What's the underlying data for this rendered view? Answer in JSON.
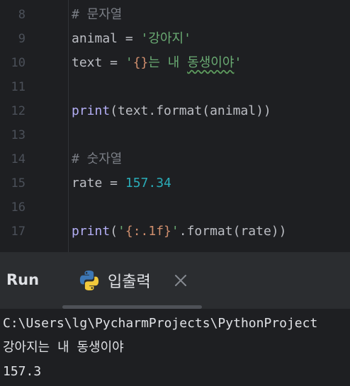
{
  "editor": {
    "lines": [
      {
        "num": "8",
        "parts": [
          {
            "t": "# 문자열",
            "c": "comment"
          }
        ]
      },
      {
        "num": "9",
        "parts": [
          {
            "t": "animal = ",
            "c": ""
          },
          {
            "t": "'강아지'",
            "c": "string"
          }
        ]
      },
      {
        "num": "10",
        "parts": [
          {
            "t": "text = ",
            "c": ""
          },
          {
            "t": "'",
            "c": "string"
          },
          {
            "t": "{}",
            "c": "brace"
          },
          {
            "t": "는 내 ",
            "c": "string"
          },
          {
            "t": "동생이야",
            "c": "string typo"
          },
          {
            "t": "'",
            "c": "string"
          }
        ]
      },
      {
        "num": "11",
        "parts": []
      },
      {
        "num": "12",
        "parts": [
          {
            "t": "print",
            "c": "func"
          },
          {
            "t": "(text.format(animal))",
            "c": ""
          }
        ]
      },
      {
        "num": "13",
        "parts": []
      },
      {
        "num": "14",
        "parts": [
          {
            "t": "# 숫자열",
            "c": "comment"
          }
        ]
      },
      {
        "num": "15",
        "parts": [
          {
            "t": "rate = ",
            "c": ""
          },
          {
            "t": "157.34",
            "c": "number"
          }
        ]
      },
      {
        "num": "16",
        "parts": []
      },
      {
        "num": "17",
        "parts": [
          {
            "t": "print",
            "c": "func"
          },
          {
            "t": "(",
            "c": ""
          },
          {
            "t": "'",
            "c": "string"
          },
          {
            "t": "{:.1f}",
            "c": "brace"
          },
          {
            "t": "'",
            "c": "string"
          },
          {
            "t": ".format(rate))",
            "c": ""
          }
        ]
      }
    ]
  },
  "run_panel": {
    "title": "Run",
    "tab_label": "입출력",
    "tab_icon": "python-icon",
    "close_icon": "close-icon"
  },
  "console": {
    "lines": [
      "C:\\Users\\lg\\PycharmProjects\\PythonProject",
      "강아지는 내 동생이야",
      "157.3"
    ]
  },
  "colors": {
    "editor_bg": "#1e1f22",
    "panel_bg": "#2b2d30",
    "comment": "#7a7e85",
    "string": "#6aab73",
    "number": "#2aacb8",
    "function": "#b3aef5",
    "brace": "#cf8e6d"
  }
}
